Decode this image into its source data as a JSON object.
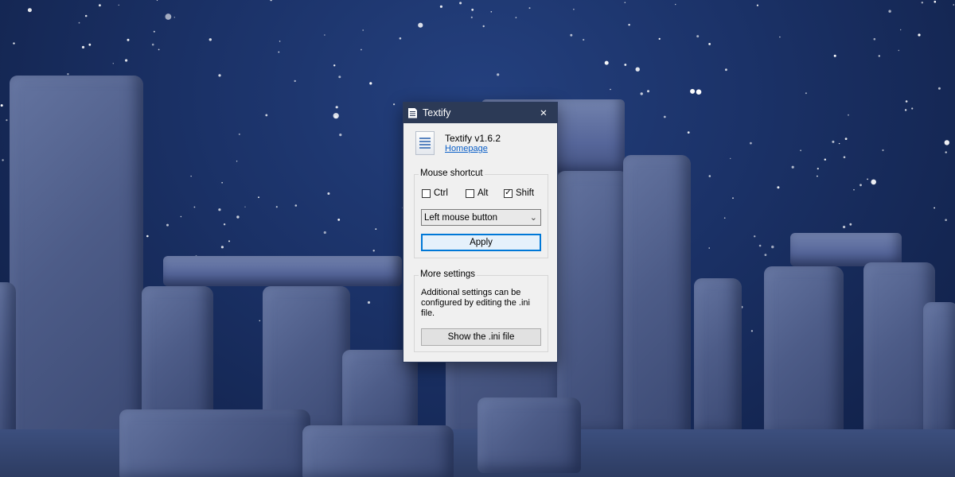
{
  "window": {
    "title": "Textify",
    "close_glyph": "✕",
    "title_icon": "document-icon"
  },
  "about": {
    "app_name": "Textify v1.6.2",
    "homepage_label": "Homepage",
    "app_icon": "document-lines-icon"
  },
  "mouse_shortcut": {
    "group_label": "Mouse shortcut",
    "ctrl": {
      "label": "Ctrl",
      "checked": false,
      "mark": ""
    },
    "alt": {
      "label": "Alt",
      "checked": false,
      "mark": ""
    },
    "shift": {
      "label": "Shift",
      "checked": true,
      "mark": "✓"
    },
    "button_select": {
      "value": "Left mouse button",
      "chevron": "⌄"
    },
    "apply_label": "Apply"
  },
  "more_settings": {
    "group_label": "More settings",
    "description": "Additional settings can be configured by editing the .ini file.",
    "show_ini_label": "Show the .ini file"
  },
  "colors": {
    "titlebar": "#2c3a56",
    "link": "#0b5fc7",
    "focus": "#0078d7"
  }
}
